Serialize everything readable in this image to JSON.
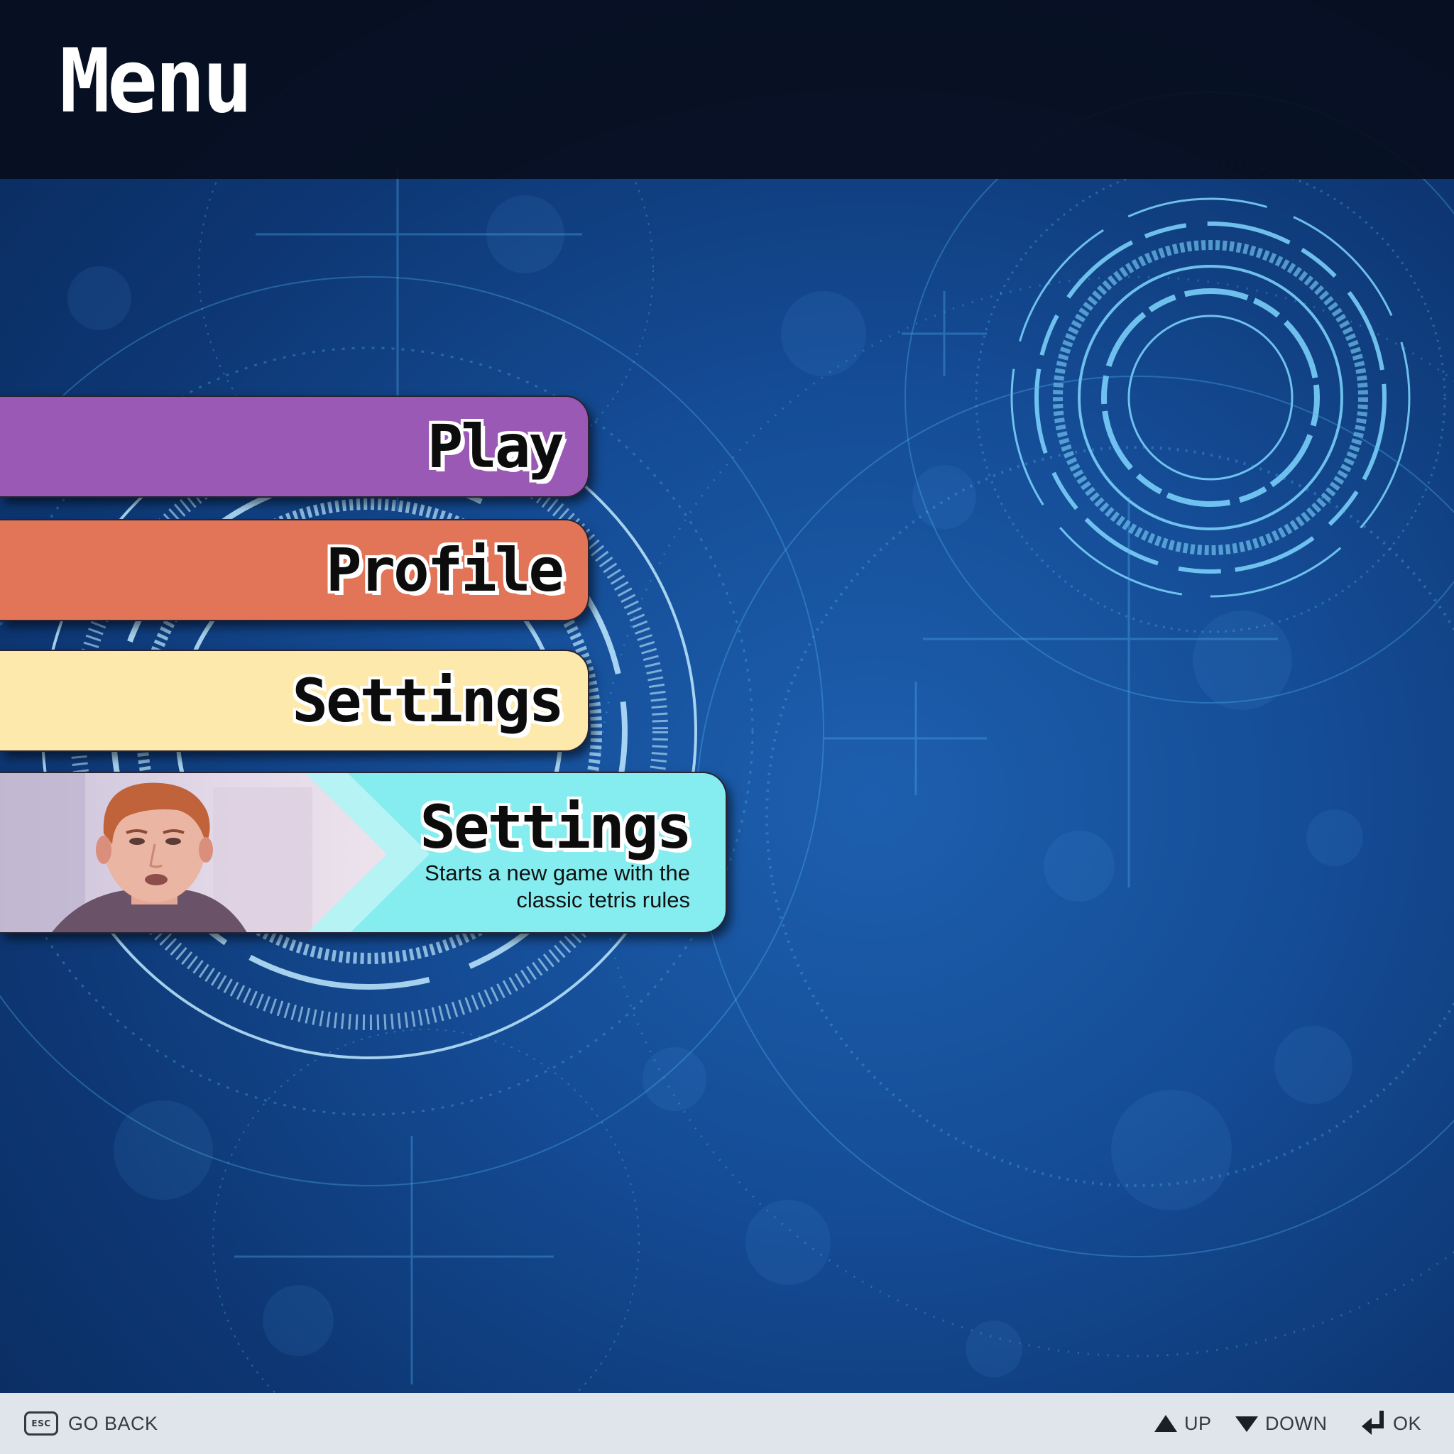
{
  "header": {
    "title": "Menu"
  },
  "menu": {
    "items": [
      {
        "label": "Play",
        "color": "#9b59b6"
      },
      {
        "label": "Profile",
        "color": "#e27457"
      },
      {
        "label": "Settings",
        "color": "#fde9ac"
      }
    ],
    "selected": {
      "label": "Settings",
      "description": "Starts a new game with the classic tetris rules",
      "color": "#85ecef",
      "preview_icon": "video-still-portrait"
    }
  },
  "footer": {
    "back": {
      "key": "ESC",
      "label": "GO BACK"
    },
    "up": {
      "icon": "triangle-up-icon",
      "label": "UP"
    },
    "down": {
      "icon": "triangle-down-icon",
      "label": "DOWN"
    },
    "ok": {
      "icon": "enter-key-icon",
      "label": "OK"
    }
  },
  "colors": {
    "header_bg": "#080e1e",
    "background": "#154d97",
    "footer_bg": "#dfe5ea"
  }
}
